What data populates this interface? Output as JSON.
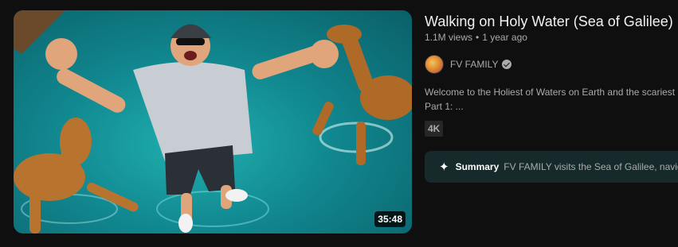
{
  "video": {
    "title": "Walking on Holy Water (Sea of Galilee)",
    "views": "1.1M views",
    "separator": "•",
    "age": "1 year ago",
    "duration": "35:48",
    "badge": "4K",
    "thumbnail_icon": "video-thumbnail"
  },
  "channel": {
    "name": "FV FAMILY",
    "verified_icon": "verified-check-icon"
  },
  "description": {
    "line1": "Welcome to the Holiest of Waters on Earth and the scariest",
    "line2": "Part 1: ..."
  },
  "summary": {
    "icon": "sparkle-icon",
    "label": "Summary",
    "text": "FV FAMILY visits the Sea of Galilee, naviga"
  },
  "colors": {
    "background": "#0f0f0f",
    "summary_bg": "#162a2c",
    "water": "#11878f"
  }
}
